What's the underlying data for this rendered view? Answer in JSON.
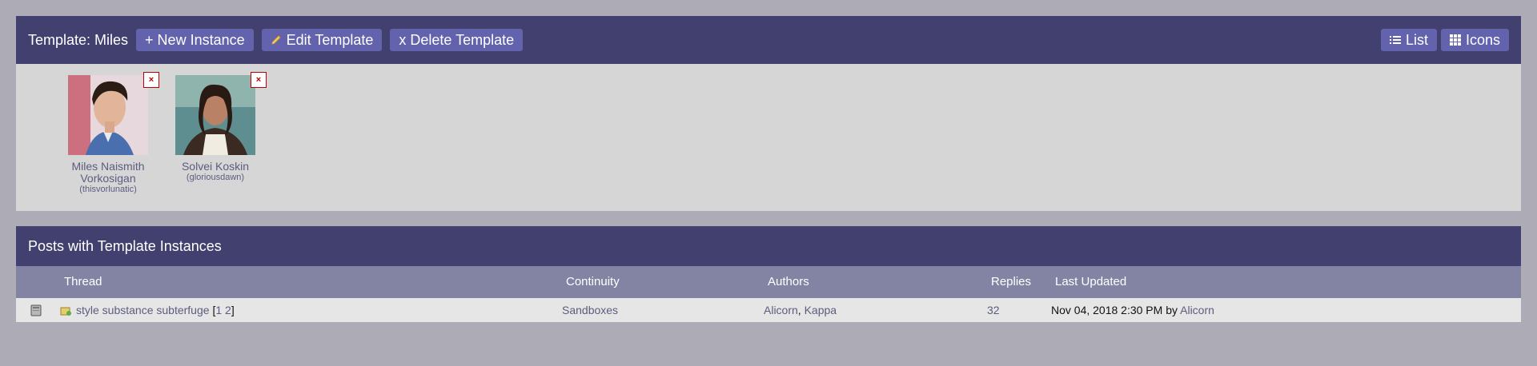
{
  "template": {
    "title": "Template: Miles",
    "buttons": {
      "new_instance": "+ New Instance",
      "edit_template": "Edit Template",
      "delete_template": "x Delete Template",
      "list": "List",
      "icons": "Icons"
    },
    "characters": [
      {
        "name": "Miles Naismith Vorkosigan",
        "screenname": "(thisvorlunatic)",
        "delete_label": "×"
      },
      {
        "name": "Solvei Koskin",
        "screenname": "(gloriousdawn)",
        "delete_label": "×"
      }
    ]
  },
  "posts": {
    "title": "Posts with Template Instances",
    "columns": {
      "thread": "Thread",
      "continuity": "Continuity",
      "authors": "Authors",
      "replies": "Replies",
      "last_updated": "Last Updated"
    },
    "rows": [
      {
        "thread": "style substance subterfuge",
        "bracket_open": "[",
        "pages": [
          "1",
          "2"
        ],
        "bracket_close": "]",
        "continuity": "Sandboxes",
        "authors": [
          "Alicorn",
          "Kappa"
        ],
        "author_separator": ",",
        "replies": "32",
        "last_updated": "Nov 04, 2018 2:30 PM",
        "by_label": "by",
        "last_author": "Alicorn"
      }
    ]
  },
  "icons": {
    "edit": "pencil-icon",
    "list": "list-icon",
    "grid": "grid-icon",
    "post_status": "unread-post-icon",
    "thread": "thread-icon"
  },
  "colors": {
    "header_bg": "#41406e",
    "button_bg": "#6262ad",
    "table_head_bg": "#8384a4",
    "body_bg": "#d6d6d6",
    "page_bg": "#adabb5",
    "link": "#5c5c7f"
  }
}
